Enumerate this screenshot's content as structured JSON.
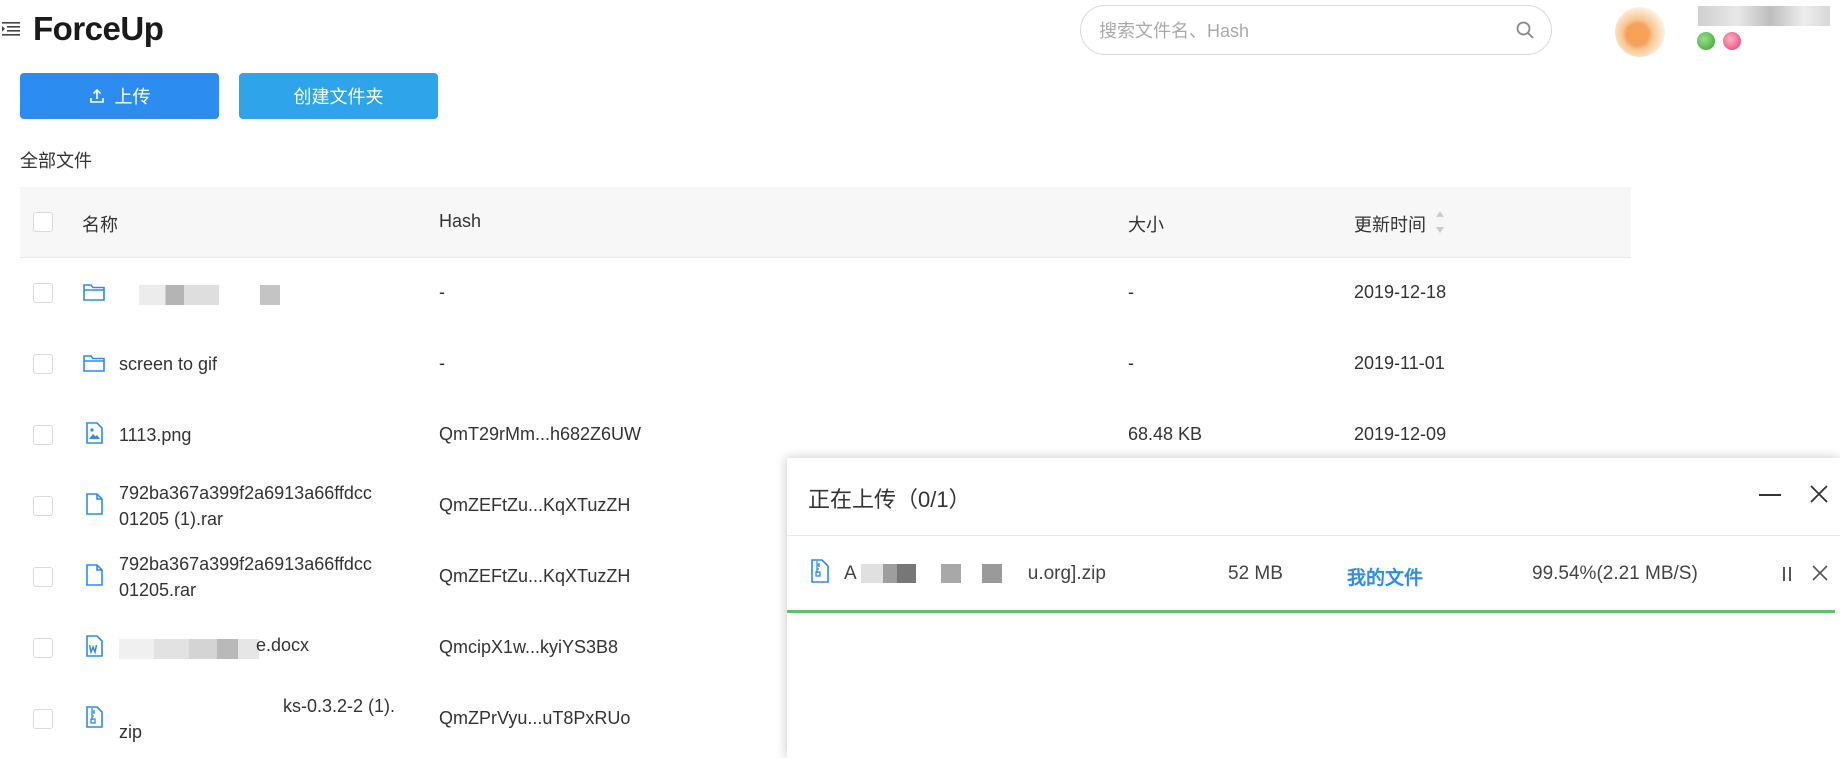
{
  "header": {
    "logo": "ForceUp",
    "search_placeholder": "搜索文件名、Hash"
  },
  "toolbar": {
    "upload_label": "上传",
    "new_folder_label": "创建文件夹"
  },
  "breadcrumb": "全部文件",
  "table": {
    "headers": {
      "name": "名称",
      "hash": "Hash",
      "size": "大小",
      "time": "更新时间"
    },
    "rows": [
      {
        "type": "folder",
        "name": "",
        "hash": "-",
        "size": "-",
        "time": "2019-12-18"
      },
      {
        "type": "folder",
        "name": "screen to gif",
        "hash": "-",
        "size": "-",
        "time": "2019-11-01"
      },
      {
        "type": "image",
        "name": "1113.png",
        "hash": "QmT29rMm...h682Z6UW",
        "size": "68.48 KB",
        "time": "2019-12-09"
      },
      {
        "type": "file",
        "name_line1": "792ba367a399f2a6913a66ffdcc",
        "name_line2": "01205 (1).rar",
        "hash": "QmZEFtZu...KqXTuzZH"
      },
      {
        "type": "file",
        "name_line1": "792ba367a399f2a6913a66ffdcc",
        "name_line2": "01205.rar",
        "hash": "QmZEFtZu...KqXTuzZH"
      },
      {
        "type": "word",
        "name": "e.docx",
        "hash": "QmcipX1w...kyiYS3B8"
      },
      {
        "type": "zip",
        "name_line1": "ks-0.3.2-2 (1).",
        "name_line2": "zip",
        "hash": "QmZPrVyu...uT8PxRUo"
      }
    ]
  },
  "upload_panel": {
    "title": "正在上传（0/1）",
    "task": {
      "name_prefix": "A",
      "name_suffix": "u.org].zip",
      "size": "52 MB",
      "target": "我的文件",
      "status": "99.54%(2.21 MB/S)",
      "progress": 0.9954
    }
  },
  "colors": {
    "primary": "#2d8cf0",
    "secondary_button": "#2ea5ea",
    "progress": "#5bc466"
  }
}
